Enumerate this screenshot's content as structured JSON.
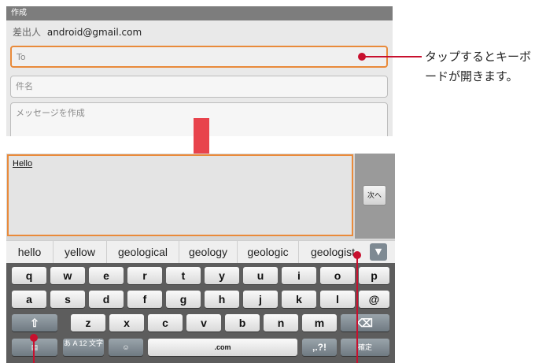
{
  "compose": {
    "title": "作成",
    "from_label": "差出人",
    "from_value": "android@gmail.com",
    "to_placeholder": "To",
    "subject_placeholder": "件名",
    "message_placeholder": "メッセージを作成"
  },
  "callout": {
    "text": "タップするとキーボードが開きます。",
    "color": "#c8102e"
  },
  "arrow": {
    "color": "#e8434c"
  },
  "editor": {
    "typed_text": "Hello",
    "next_button": "次へ"
  },
  "suggestions": [
    "hello",
    "yellow",
    "geological",
    "geology",
    "geologic",
    "geologist"
  ],
  "suggestion_toggle_icon": "chevron-down-icon",
  "keyboard": {
    "row1": [
      "q",
      "w",
      "e",
      "r",
      "t",
      "y",
      "u",
      "i",
      "o",
      "p"
    ],
    "row2": [
      "a",
      "s",
      "d",
      "f",
      "g",
      "h",
      "j",
      "k",
      "l",
      "@"
    ],
    "row3": [
      "z",
      "x",
      "c",
      "v",
      "b",
      "n",
      "m"
    ],
    "shift_icon": "shift-arrow-icon",
    "backspace_icon": "backspace-icon",
    "settings_icon": "keyboard-settings-icon",
    "mode_key": "あ A 12 文字",
    "emoji_icon": "emoji-icon",
    "space_key": ".com",
    "punct_key": ",.?!",
    "enter_key": "確定"
  },
  "accent_orange": "#e98a3a"
}
